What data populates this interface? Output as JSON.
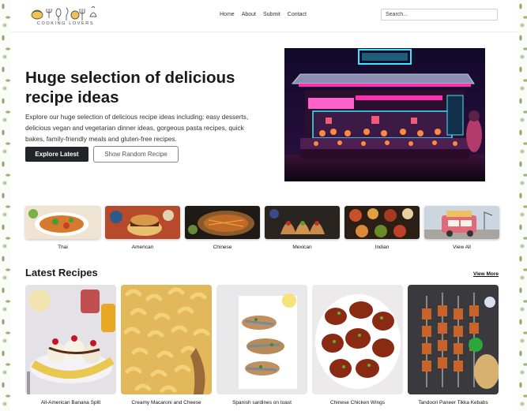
{
  "header": {
    "logo_text": "COOKING LOVERS",
    "nav": [
      "Home",
      "About",
      "Submit",
      "Contact"
    ],
    "search_placeholder": "Search..."
  },
  "hero": {
    "title": "Huge selection of delicious recipe ideas",
    "text": "Explore our huge selection of delicious recipe ideas including: easy desserts, delicious vegan and vegetarian dinner ideas, gorgeous pasta recipes, quick bakes, family-friendly meals and gluten-free recipes.",
    "primary_button": "Explore Latest",
    "secondary_button": "Show Random Recipe"
  },
  "categories": [
    "Thai",
    "American",
    "Chinese",
    "Mexican",
    "Indian",
    "View All"
  ],
  "latest": {
    "title": "Latest Recipes",
    "view_more": "View More",
    "recipes": [
      "All-American Banana Split",
      "Creamy Macaroni and Cheese",
      "Spanish sardines on toast",
      "Chinese Chicken Wings",
      "Tandoori Paneer Tikka Kebabs"
    ]
  },
  "colors": {
    "primary_button": "#212529",
    "page_pattern": "#8fa870",
    "neon_pink": "#ff2fb4",
    "neon_cyan": "#3ce6ff"
  }
}
